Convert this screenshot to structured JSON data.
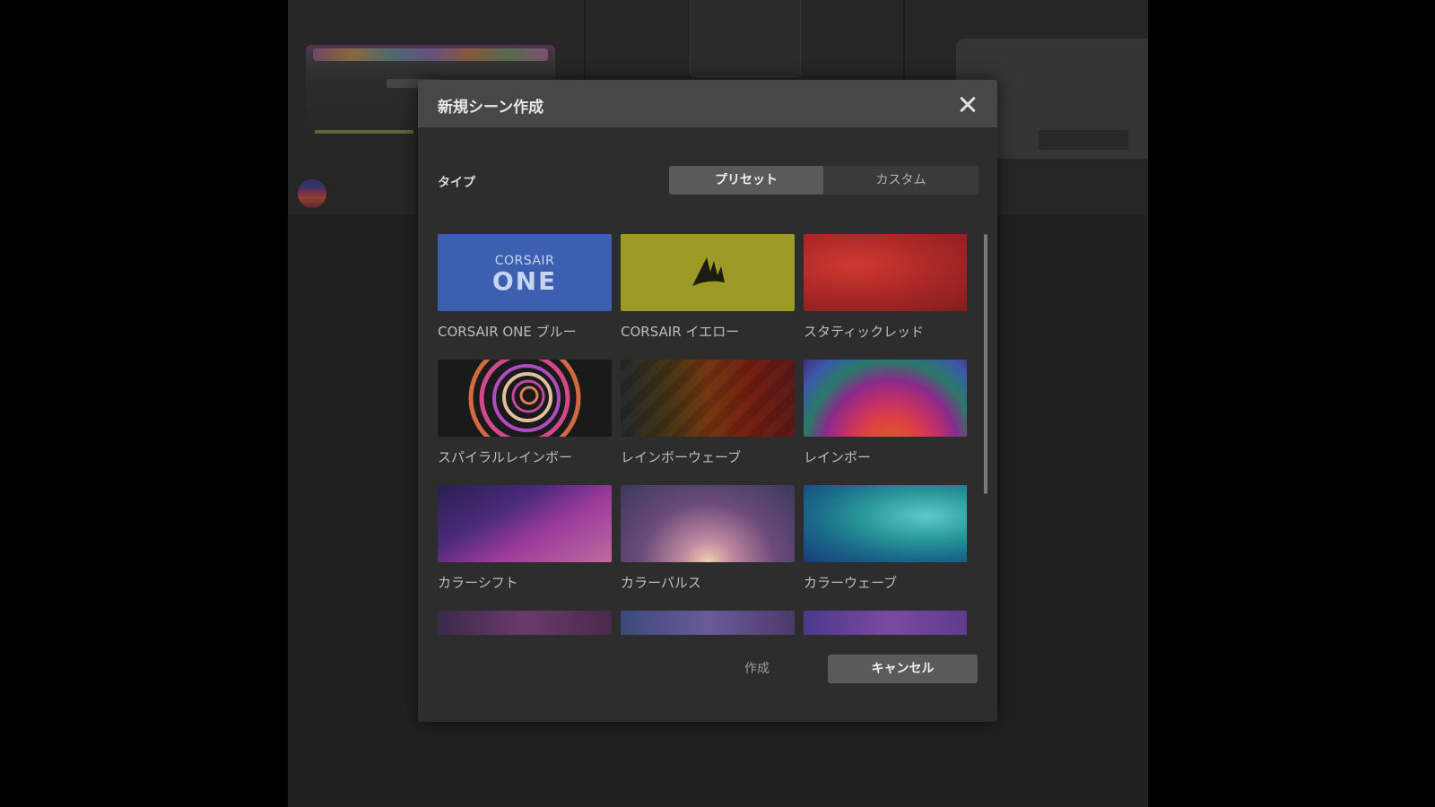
{
  "dialog": {
    "title": "新規シーン作成",
    "close_icon": "close-icon"
  },
  "type_selector": {
    "label": "タイプ",
    "options": [
      "プリセット",
      "カスタム"
    ],
    "selected": "プリセット"
  },
  "presets": [
    {
      "label": "CORSAIR ONE ブルー",
      "logo_top": "CORSAIR",
      "logo_bottom": "ONE",
      "color": "#3d5fb0"
    },
    {
      "label": "CORSAIR イエロー",
      "icon": "corsair-sails-icon",
      "color": "#9d9a25"
    },
    {
      "label": "スタティックレッド",
      "color": "#b02a28"
    },
    {
      "label": "スパイラルレインボー"
    },
    {
      "label": "レインボーウェーブ"
    },
    {
      "label": "レインボー"
    },
    {
      "label": "カラーシフト"
    },
    {
      "label": "カラーパルス"
    },
    {
      "label": "カラーウェーブ"
    }
  ],
  "footer": {
    "create_label": "作成",
    "cancel_label": "キャンセル"
  }
}
